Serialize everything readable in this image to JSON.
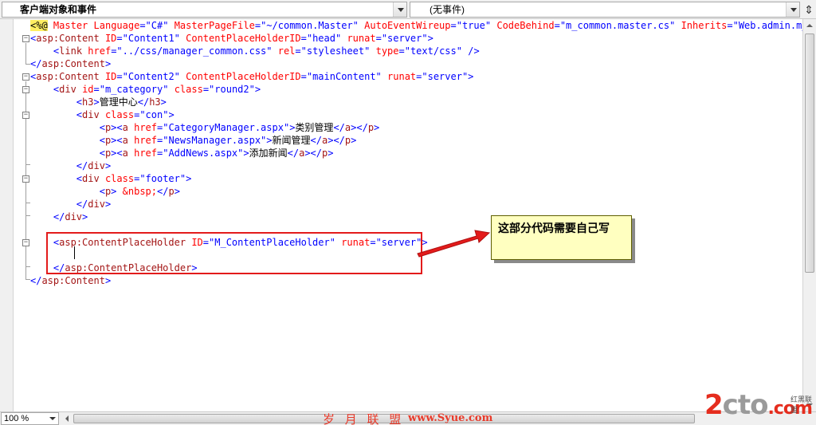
{
  "toolbar": {
    "left_dropdown": "客户端对象和事件",
    "right_dropdown": "(无事件)",
    "split_icon": "split-view-icon"
  },
  "code_lines": [
    {
      "segs": [
        [
          "dir",
          "<%@"
        ],
        [
          "txt",
          " "
        ],
        [
          "attr",
          "Master"
        ],
        [
          "txt",
          " "
        ],
        [
          "attr",
          "Language"
        ],
        [
          "br",
          "="
        ],
        [
          "val",
          "\"C#\""
        ],
        [
          "txt",
          " "
        ],
        [
          "attr",
          "MasterPageFile"
        ],
        [
          "br",
          "="
        ],
        [
          "val",
          "\"~/common.Master\""
        ],
        [
          "txt",
          " "
        ],
        [
          "attr",
          "AutoEventWireup"
        ],
        [
          "br",
          "="
        ],
        [
          "val",
          "\"true\""
        ],
        [
          "txt",
          " "
        ],
        [
          "attr",
          "CodeBehind"
        ],
        [
          "br",
          "="
        ],
        [
          "val",
          "\"m_common.master.cs\""
        ],
        [
          "txt",
          " "
        ],
        [
          "attr",
          "Inherits"
        ],
        [
          "br",
          "="
        ],
        [
          "val",
          "\"Web.admin.m_common"
        ]
      ]
    },
    {
      "segs": [
        [
          "br",
          "<"
        ],
        [
          "tag",
          "asp:Content"
        ],
        [
          "txt",
          " "
        ],
        [
          "attr",
          "ID"
        ],
        [
          "br",
          "="
        ],
        [
          "val",
          "\"Content1\""
        ],
        [
          "txt",
          " "
        ],
        [
          "attr",
          "ContentPlaceHolderID"
        ],
        [
          "br",
          "="
        ],
        [
          "val",
          "\"head\""
        ],
        [
          "txt",
          " "
        ],
        [
          "attr",
          "runat"
        ],
        [
          "br",
          "="
        ],
        [
          "val",
          "\"server\""
        ],
        [
          "br",
          ">"
        ]
      ]
    },
    {
      "segs": [
        [
          "txt",
          "    "
        ],
        [
          "br",
          "<"
        ],
        [
          "tag",
          "link"
        ],
        [
          "txt",
          " "
        ],
        [
          "attr",
          "href"
        ],
        [
          "br",
          "="
        ],
        [
          "val",
          "\"../css/manager_common.css\""
        ],
        [
          "txt",
          " "
        ],
        [
          "attr",
          "rel"
        ],
        [
          "br",
          "="
        ],
        [
          "val",
          "\"stylesheet\""
        ],
        [
          "txt",
          " "
        ],
        [
          "attr",
          "type"
        ],
        [
          "br",
          "="
        ],
        [
          "val",
          "\"text/css\""
        ],
        [
          "txt",
          " "
        ],
        [
          "br",
          "/>"
        ]
      ]
    },
    {
      "segs": [
        [
          "br",
          "</"
        ],
        [
          "tag",
          "asp:Content"
        ],
        [
          "br",
          ">"
        ]
      ]
    },
    {
      "segs": [
        [
          "br",
          "<"
        ],
        [
          "tag",
          "asp:Content"
        ],
        [
          "txt",
          " "
        ],
        [
          "attr",
          "ID"
        ],
        [
          "br",
          "="
        ],
        [
          "val",
          "\"Content2\""
        ],
        [
          "txt",
          " "
        ],
        [
          "attr",
          "ContentPlaceHolderID"
        ],
        [
          "br",
          "="
        ],
        [
          "val",
          "\"mainContent\""
        ],
        [
          "txt",
          " "
        ],
        [
          "attr",
          "runat"
        ],
        [
          "br",
          "="
        ],
        [
          "val",
          "\"server\""
        ],
        [
          "br",
          ">"
        ]
      ]
    },
    {
      "segs": [
        [
          "txt",
          "    "
        ],
        [
          "br",
          "<"
        ],
        [
          "tag",
          "div"
        ],
        [
          "txt",
          " "
        ],
        [
          "attr",
          "id"
        ],
        [
          "br",
          "="
        ],
        [
          "val",
          "\"m_category\""
        ],
        [
          "txt",
          " "
        ],
        [
          "attr",
          "class"
        ],
        [
          "br",
          "="
        ],
        [
          "val",
          "\"round2\""
        ],
        [
          "br",
          ">"
        ]
      ]
    },
    {
      "segs": [
        [
          "txt",
          "        "
        ],
        [
          "br",
          "<"
        ],
        [
          "tag",
          "h3"
        ],
        [
          "br",
          ">"
        ],
        [
          "txt",
          "管理中心"
        ],
        [
          "br",
          "</"
        ],
        [
          "tag",
          "h3"
        ],
        [
          "br",
          ">"
        ]
      ]
    },
    {
      "segs": [
        [
          "txt",
          "        "
        ],
        [
          "br",
          "<"
        ],
        [
          "tag",
          "div"
        ],
        [
          "txt",
          " "
        ],
        [
          "attr",
          "class"
        ],
        [
          "br",
          "="
        ],
        [
          "val",
          "\"con\""
        ],
        [
          "br",
          ">"
        ]
      ]
    },
    {
      "segs": [
        [
          "txt",
          "            "
        ],
        [
          "br",
          "<"
        ],
        [
          "tag",
          "p"
        ],
        [
          "br",
          "><"
        ],
        [
          "tag",
          "a"
        ],
        [
          "txt",
          " "
        ],
        [
          "attr",
          "href"
        ],
        [
          "br",
          "="
        ],
        [
          "val",
          "\"CategoryManager.aspx\""
        ],
        [
          "br",
          ">"
        ],
        [
          "txt",
          "类别管理"
        ],
        [
          "br",
          "</"
        ],
        [
          "tag",
          "a"
        ],
        [
          "br",
          "></"
        ],
        [
          "tag",
          "p"
        ],
        [
          "br",
          ">"
        ]
      ]
    },
    {
      "segs": [
        [
          "txt",
          "            "
        ],
        [
          "br",
          "<"
        ],
        [
          "tag",
          "p"
        ],
        [
          "br",
          "><"
        ],
        [
          "tag",
          "a"
        ],
        [
          "txt",
          " "
        ],
        [
          "attr",
          "href"
        ],
        [
          "br",
          "="
        ],
        [
          "val",
          "\"NewsManager.aspx\""
        ],
        [
          "br",
          ">"
        ],
        [
          "txt",
          "新闻管理"
        ],
        [
          "br",
          "</"
        ],
        [
          "tag",
          "a"
        ],
        [
          "br",
          "></"
        ],
        [
          "tag",
          "p"
        ],
        [
          "br",
          ">"
        ]
      ]
    },
    {
      "segs": [
        [
          "txt",
          "            "
        ],
        [
          "br",
          "<"
        ],
        [
          "tag",
          "p"
        ],
        [
          "br",
          "><"
        ],
        [
          "tag",
          "a"
        ],
        [
          "txt",
          " "
        ],
        [
          "attr",
          "href"
        ],
        [
          "br",
          "="
        ],
        [
          "val",
          "\"AddNews.aspx\""
        ],
        [
          "br",
          ">"
        ],
        [
          "txt",
          "添加新闻"
        ],
        [
          "br",
          "</"
        ],
        [
          "tag",
          "a"
        ],
        [
          "br",
          "></"
        ],
        [
          "tag",
          "p"
        ],
        [
          "br",
          ">"
        ]
      ]
    },
    {
      "segs": [
        [
          "txt",
          "        "
        ],
        [
          "br",
          "</"
        ],
        [
          "tag",
          "div"
        ],
        [
          "br",
          ">"
        ]
      ]
    },
    {
      "segs": [
        [
          "txt",
          "        "
        ],
        [
          "br",
          "<"
        ],
        [
          "tag",
          "div"
        ],
        [
          "txt",
          " "
        ],
        [
          "attr",
          "class"
        ],
        [
          "br",
          "="
        ],
        [
          "val",
          "\"footer\""
        ],
        [
          "br",
          ">"
        ]
      ]
    },
    {
      "segs": [
        [
          "txt",
          "            "
        ],
        [
          "br",
          "<"
        ],
        [
          "tag",
          "p"
        ],
        [
          "br",
          ">"
        ],
        [
          "txt",
          " "
        ],
        [
          "attr",
          "&nbsp;"
        ],
        [
          "br",
          "</"
        ],
        [
          "tag",
          "p"
        ],
        [
          "br",
          ">"
        ]
      ]
    },
    {
      "segs": [
        [
          "txt",
          "        "
        ],
        [
          "br",
          "</"
        ],
        [
          "tag",
          "div"
        ],
        [
          "br",
          ">"
        ]
      ]
    },
    {
      "segs": [
        [
          "txt",
          "    "
        ],
        [
          "br",
          "</"
        ],
        [
          "tag",
          "div"
        ],
        [
          "br",
          ">"
        ]
      ]
    },
    {
      "segs": []
    },
    {
      "segs": [
        [
          "txt",
          "    "
        ],
        [
          "br",
          "<"
        ],
        [
          "tag",
          "asp:ContentPlaceHolder"
        ],
        [
          "txt",
          " "
        ],
        [
          "attr",
          "ID"
        ],
        [
          "br",
          "="
        ],
        [
          "val",
          "\"M_ContentPlaceHolder\""
        ],
        [
          "txt",
          " "
        ],
        [
          "attr",
          "runat"
        ],
        [
          "br",
          "="
        ],
        [
          "val",
          "\"server\""
        ],
        [
          "br",
          ">"
        ]
      ]
    },
    {
      "segs": []
    },
    {
      "segs": [
        [
          "txt",
          "    "
        ],
        [
          "br",
          "</"
        ],
        [
          "tag",
          "asp:ContentPlaceHolder"
        ],
        [
          "br",
          ">"
        ]
      ]
    },
    {
      "segs": [
        [
          "br",
          "</"
        ],
        [
          "tag",
          "asp:Content"
        ],
        [
          "br",
          ">"
        ]
      ]
    }
  ],
  "annotation": {
    "text": "这部分代码需要自己写"
  },
  "statusbar": {
    "zoom": "100 %"
  },
  "watermark": {
    "chinese": "岁 月 联 盟",
    "url": "www.Syue.com",
    "logo_main_a": "2",
    "logo_main_b": "cto",
    "logo_dot": ".com",
    "logo_sub": "红黑联盟"
  }
}
